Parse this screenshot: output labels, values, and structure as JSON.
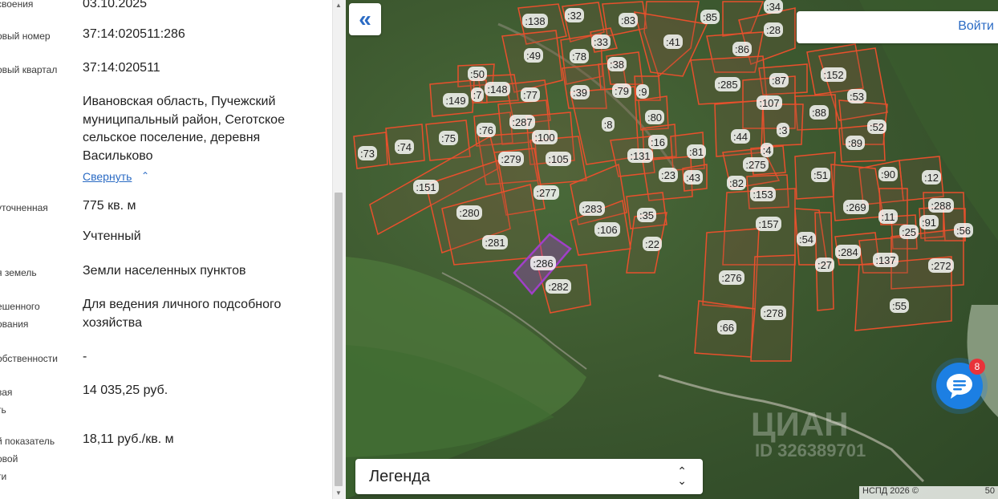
{
  "panel": {
    "rows": [
      {
        "label": "своения",
        "value": "03.10.2025"
      },
      {
        "label": "овый номер",
        "value": "37:14:020511:286"
      },
      {
        "label": "овый квартал",
        "value": "37:14:020511"
      },
      {
        "label": "",
        "value": "Ивановская область, Пучежский муниципальный район, Сеготское сельское поселение, деревня Васильково"
      },
      {
        "label": "уточненная",
        "value": "775 кв. м"
      },
      {
        "label": "",
        "value": "Учтенный"
      },
      {
        "label": "я земель",
        "value": "Земли населенных пунктов"
      },
      {
        "label": "ешенного\nования",
        "value": "Для ведения личного подсобного хозяйства"
      },
      {
        "label": "обственности",
        "value": "-"
      },
      {
        "label": "вая\nть",
        "value": "14 035,25 руб."
      },
      {
        "label": "й показатель\nовой\nти",
        "value": "18,11 руб./кв. м"
      }
    ],
    "collapse_link": "Свернуть"
  },
  "map": {
    "login_label": "Войти",
    "legend_label": "Легенда",
    "chat_badge": "8",
    "watermark": "ЦИАН",
    "watermark_id": "ID 326389701",
    "copyright": "НСПД 2026 ©",
    "scale": "50",
    "parcel_color": "#e8502c",
    "selected_color": "#a040c8",
    "parcels": [
      "138",
      "32",
      "83",
      "85",
      "34",
      "28",
      "49",
      "78",
      "33",
      "41",
      "86",
      "50",
      "148",
      "7",
      "149",
      "77",
      "39",
      "79",
      "38",
      "9",
      "285",
      "87",
      "152",
      "107",
      "53",
      "76",
      "287",
      "100",
      "8",
      "80",
      "88",
      "52",
      "73",
      "74",
      "75",
      "279",
      "105",
      "16",
      "131",
      "81",
      "44",
      "3",
      "89",
      "151",
      "277",
      "283",
      "23",
      "43",
      "275",
      "4",
      "82",
      "153",
      "51",
      "90",
      "12",
      "280",
      "106",
      "35",
      "157",
      "269",
      "288",
      "11",
      "91",
      "56",
      "25",
      "281",
      "22",
      "54",
      "284",
      "27",
      "137",
      "272",
      "286",
      "282",
      "276",
      "278",
      "55",
      "66"
    ]
  }
}
